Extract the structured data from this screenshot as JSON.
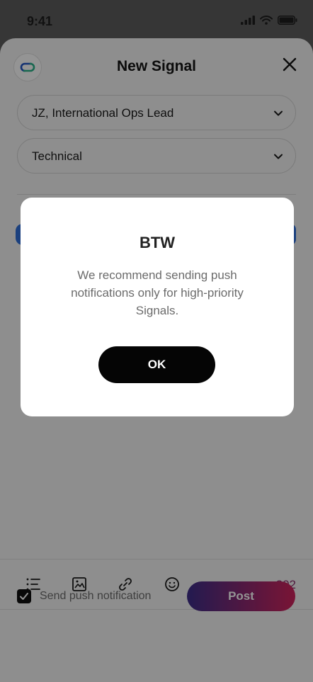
{
  "status_bar": {
    "time": "9:41"
  },
  "header": {
    "title": "New Signal",
    "logo_icon": "app-logo-icon",
    "close_icon": "close-icon"
  },
  "form": {
    "recipient_value": "JZ, International Ops Lead",
    "category_value": "Technical"
  },
  "toolbar": {
    "icons": [
      "list-icon",
      "image-icon",
      "link-icon",
      "emoji-icon"
    ],
    "char_count": "302"
  },
  "footer": {
    "push_label": "Send push notification",
    "push_checked": true,
    "post_label": "Post"
  },
  "dialog": {
    "title": "BTW",
    "body": "We recommend sending push notifications only for high-priority Signals.",
    "ok_label": "OK"
  },
  "colors": {
    "accent_gradient_start": "#3d2e8a",
    "accent_gradient_end": "#d1245c",
    "char_count": "#8c2f6e"
  }
}
